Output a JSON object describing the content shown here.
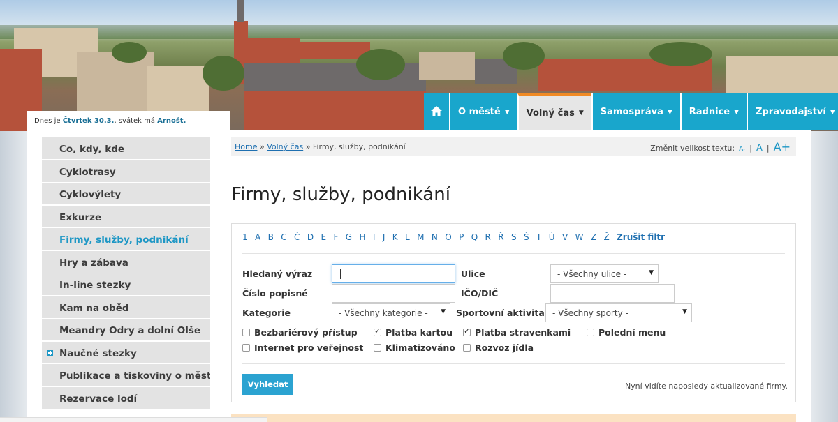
{
  "header": {
    "date_prefix": "Dnes je ",
    "date_day": "Čtvrtek 30.3.",
    "name_day_prefix": ", svátek má ",
    "name_day": "Arnošt."
  },
  "nav": {
    "home_icon": "home-icon",
    "items": [
      {
        "label": "O městě"
      },
      {
        "label": "Volný čas"
      },
      {
        "label": "Samospráva"
      },
      {
        "label": "Radnice"
      },
      {
        "label": "Zpravodajství"
      }
    ],
    "accent": "#19a6cc",
    "active_border": "#f08a24"
  },
  "sidebar": {
    "items": [
      {
        "label": "Co, kdy, kde"
      },
      {
        "label": "Cyklotrasy"
      },
      {
        "label": "Cyklovýlety"
      },
      {
        "label": "Exkurze"
      },
      {
        "label": "Firmy, služby, podnikání"
      },
      {
        "label": "Hry a zábava"
      },
      {
        "label": "In-line stezky"
      },
      {
        "label": "Kam na oběd"
      },
      {
        "label": "Meandry Odry a dolní Olše"
      },
      {
        "label": "Naučné stezky"
      },
      {
        "label": "Publikace a tiskoviny o městě"
      },
      {
        "label": "Rezervace lodí"
      }
    ]
  },
  "breadcrumb": {
    "home": "Home",
    "sep": "»",
    "parent": "Volný čas",
    "current": "Firmy, služby, podnikání"
  },
  "font_size": {
    "label": "Změnit velikost textu:",
    "small": "A-",
    "medium": "A",
    "large": "A+",
    "divider": "|"
  },
  "page_title": "Firmy, služby, podnikání",
  "filter": {
    "letters": [
      "1",
      "A",
      "B",
      "C",
      "Č",
      "D",
      "E",
      "F",
      "G",
      "H",
      "I",
      "J",
      "K",
      "L",
      "M",
      "N",
      "O",
      "P",
      "Q",
      "R",
      "Ř",
      "S",
      "Š",
      "T",
      "Ú",
      "V",
      "W",
      "Z",
      "Ž"
    ],
    "clear_label": "Zrušit filtr",
    "search_label": "Hledaný výraz",
    "search_value": "",
    "street_label": "Ulice",
    "street_value": "- Všechny ulice -",
    "number_label": "Číslo popisné",
    "number_value": "",
    "ico_label": "IČO/DIČ",
    "ico_value": "",
    "category_label": "Kategorie",
    "category_value": "- Všechny kategorie -",
    "sport_label": "Sportovní aktivita",
    "sport_value": "- Všechny sporty -",
    "checkboxes": [
      {
        "label": "Bezbariérový přístup",
        "checked": false
      },
      {
        "label": "Platba kartou",
        "checked": true
      },
      {
        "label": "Platba stravenkami",
        "checked": true
      },
      {
        "label": "Polední menu",
        "checked": false
      },
      {
        "label": "Internet pro veřejnost",
        "checked": false
      },
      {
        "label": "Klimatizováno",
        "checked": false
      },
      {
        "label": "Rozvoz jídla",
        "checked": false
      }
    ],
    "submit_label": "Vyhledat",
    "note": "Nyní vidíte naposledy aktualizované firmy."
  }
}
